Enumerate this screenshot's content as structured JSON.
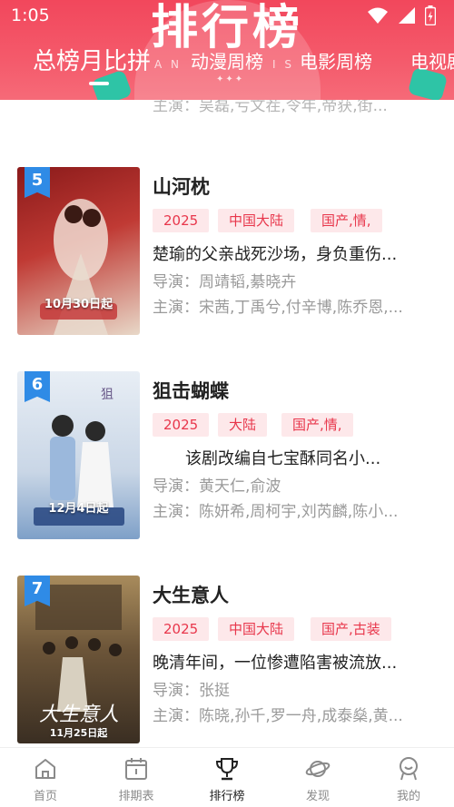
{
  "status_bar": {
    "time": "1:05"
  },
  "header": {
    "title": "排行榜",
    "deco_left": "A N",
    "deco_right": "I S",
    "deco_dots": "✦✦✦",
    "tabs": [
      {
        "label": "总榜月比拼",
        "active": true
      },
      {
        "label": "动漫周榜",
        "active": false
      },
      {
        "label": "电影周榜",
        "active": false
      },
      {
        "label": "电视剧",
        "active": false
      }
    ]
  },
  "list": {
    "previous_cast": "主演：吴磊,亏文茬,令年,帝获,街..."
  },
  "items": [
    {
      "rank": "5",
      "title": "山河枕",
      "tags": [
        "2025",
        "中国大陆",
        "国产,情,"
      ],
      "description": "楚瑜的父亲战死沙场，身负重伤...",
      "director": "导演：周靖韬,綦晓卉",
      "cast": "主演：宋茜,丁禹兮,付辛博,陈乔恩,...",
      "poster_caption": "10月30日起",
      "poster_colors": [
        "#8a1a1a",
        "#c03a34",
        "#e8d8c8"
      ]
    },
    {
      "rank": "6",
      "title": "狙击蝴蝶",
      "tags": [
        "2025",
        "大陆",
        "国产,情,"
      ],
      "description": "　　该剧改编自七宝酥同名小...",
      "director": "导演：黄天仁,俞波",
      "cast": "主演：陈妍希,周柯宇,刘芮麟,陈小...",
      "poster_caption": "12月4日起",
      "poster_colors": [
        "#c9d6e6",
        "#e8eef5",
        "#7ea0c8"
      ]
    },
    {
      "rank": "7",
      "title": "大生意人",
      "tags": [
        "2025",
        "中国大陆",
        "国产,古装"
      ],
      "description": "晚清年间，一位惨遭陷害被流放...",
      "director": "导演：张挺",
      "cast": "主演：陈晓,孙千,罗一舟,成泰燊,黄...",
      "poster_caption": "11月25日起",
      "poster_colors": [
        "#3a2e22",
        "#6b5438",
        "#a88b5c"
      ]
    }
  ],
  "bottom_nav": [
    {
      "label": "首页",
      "icon": "home-icon",
      "active": false
    },
    {
      "label": "排期表",
      "icon": "calendar-icon",
      "active": false
    },
    {
      "label": "排行榜",
      "icon": "trophy-icon",
      "active": true
    },
    {
      "label": "发现",
      "icon": "planet-icon",
      "active": false
    },
    {
      "label": "我的",
      "icon": "profile-icon",
      "active": false
    }
  ],
  "colors": {
    "header": "#f2475c",
    "tag_bg": "#fde8ea",
    "tag_text": "#e8364b",
    "rank_badge": "#2f8be6"
  }
}
